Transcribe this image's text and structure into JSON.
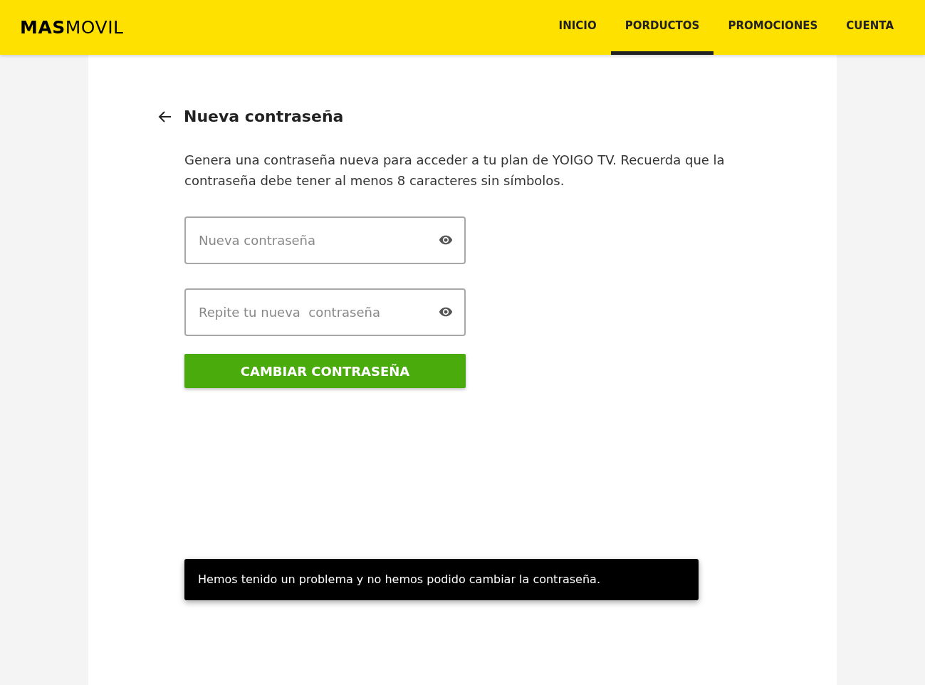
{
  "header": {
    "logo": "**MAS**MOVIL",
    "nav": [
      {
        "label": "INICIO",
        "selected": false
      },
      {
        "label": "PORDUCTOS",
        "selected": true
      },
      {
        "label": "PROMOCIONES",
        "selected": false
      },
      {
        "label": "CUENTA",
        "selected": false
      }
    ]
  },
  "page": {
    "title": "Nueva contraseña",
    "description": "Genera una contraseña nueva para acceder a tu plan de YOIGO TV. Recuerda que la contraseña debe tener al menos 8 caracteres sin símbolos.",
    "fields": [
      {
        "placeholder": "Nueva contraseña"
      },
      {
        "placeholder": "Repite tu nueva  contraseña"
      }
    ],
    "button": "CAMBIAR CONTRASEÑA"
  },
  "toast": {
    "message": "Hemos tenido un problema y no hemos podido cambiar la contraseña."
  }
}
